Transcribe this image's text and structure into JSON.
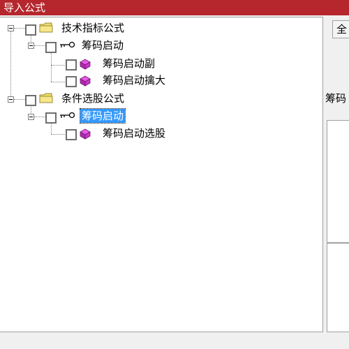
{
  "window": {
    "title": "导入公式"
  },
  "tree": {
    "nodes": [
      {
        "label": "技术指标公式",
        "icon": "folder-icon",
        "expanded": true,
        "checked": false
      },
      {
        "label": "筹码启动",
        "icon": "key-icon",
        "expanded": true,
        "checked": false
      },
      {
        "label": "筹码启动副",
        "icon": "cube-icon",
        "checked": false
      },
      {
        "label": "筹码启动擒大",
        "icon": "cube-icon",
        "checked": false
      },
      {
        "label": "条件选股公式",
        "icon": "folder-icon",
        "expanded": true,
        "checked": false
      },
      {
        "label": "筹码启动",
        "icon": "key-icon",
        "expanded": true,
        "checked": false,
        "selected": true
      },
      {
        "label": "筹码启动选股",
        "icon": "cube-icon",
        "checked": false
      }
    ]
  },
  "right": {
    "button_label": "全",
    "label": "筹码"
  },
  "colors": {
    "titlebar": "#b5272d",
    "selection": "#3399ff",
    "cube": "#cc33cc",
    "folder": "#f2dc6b"
  }
}
